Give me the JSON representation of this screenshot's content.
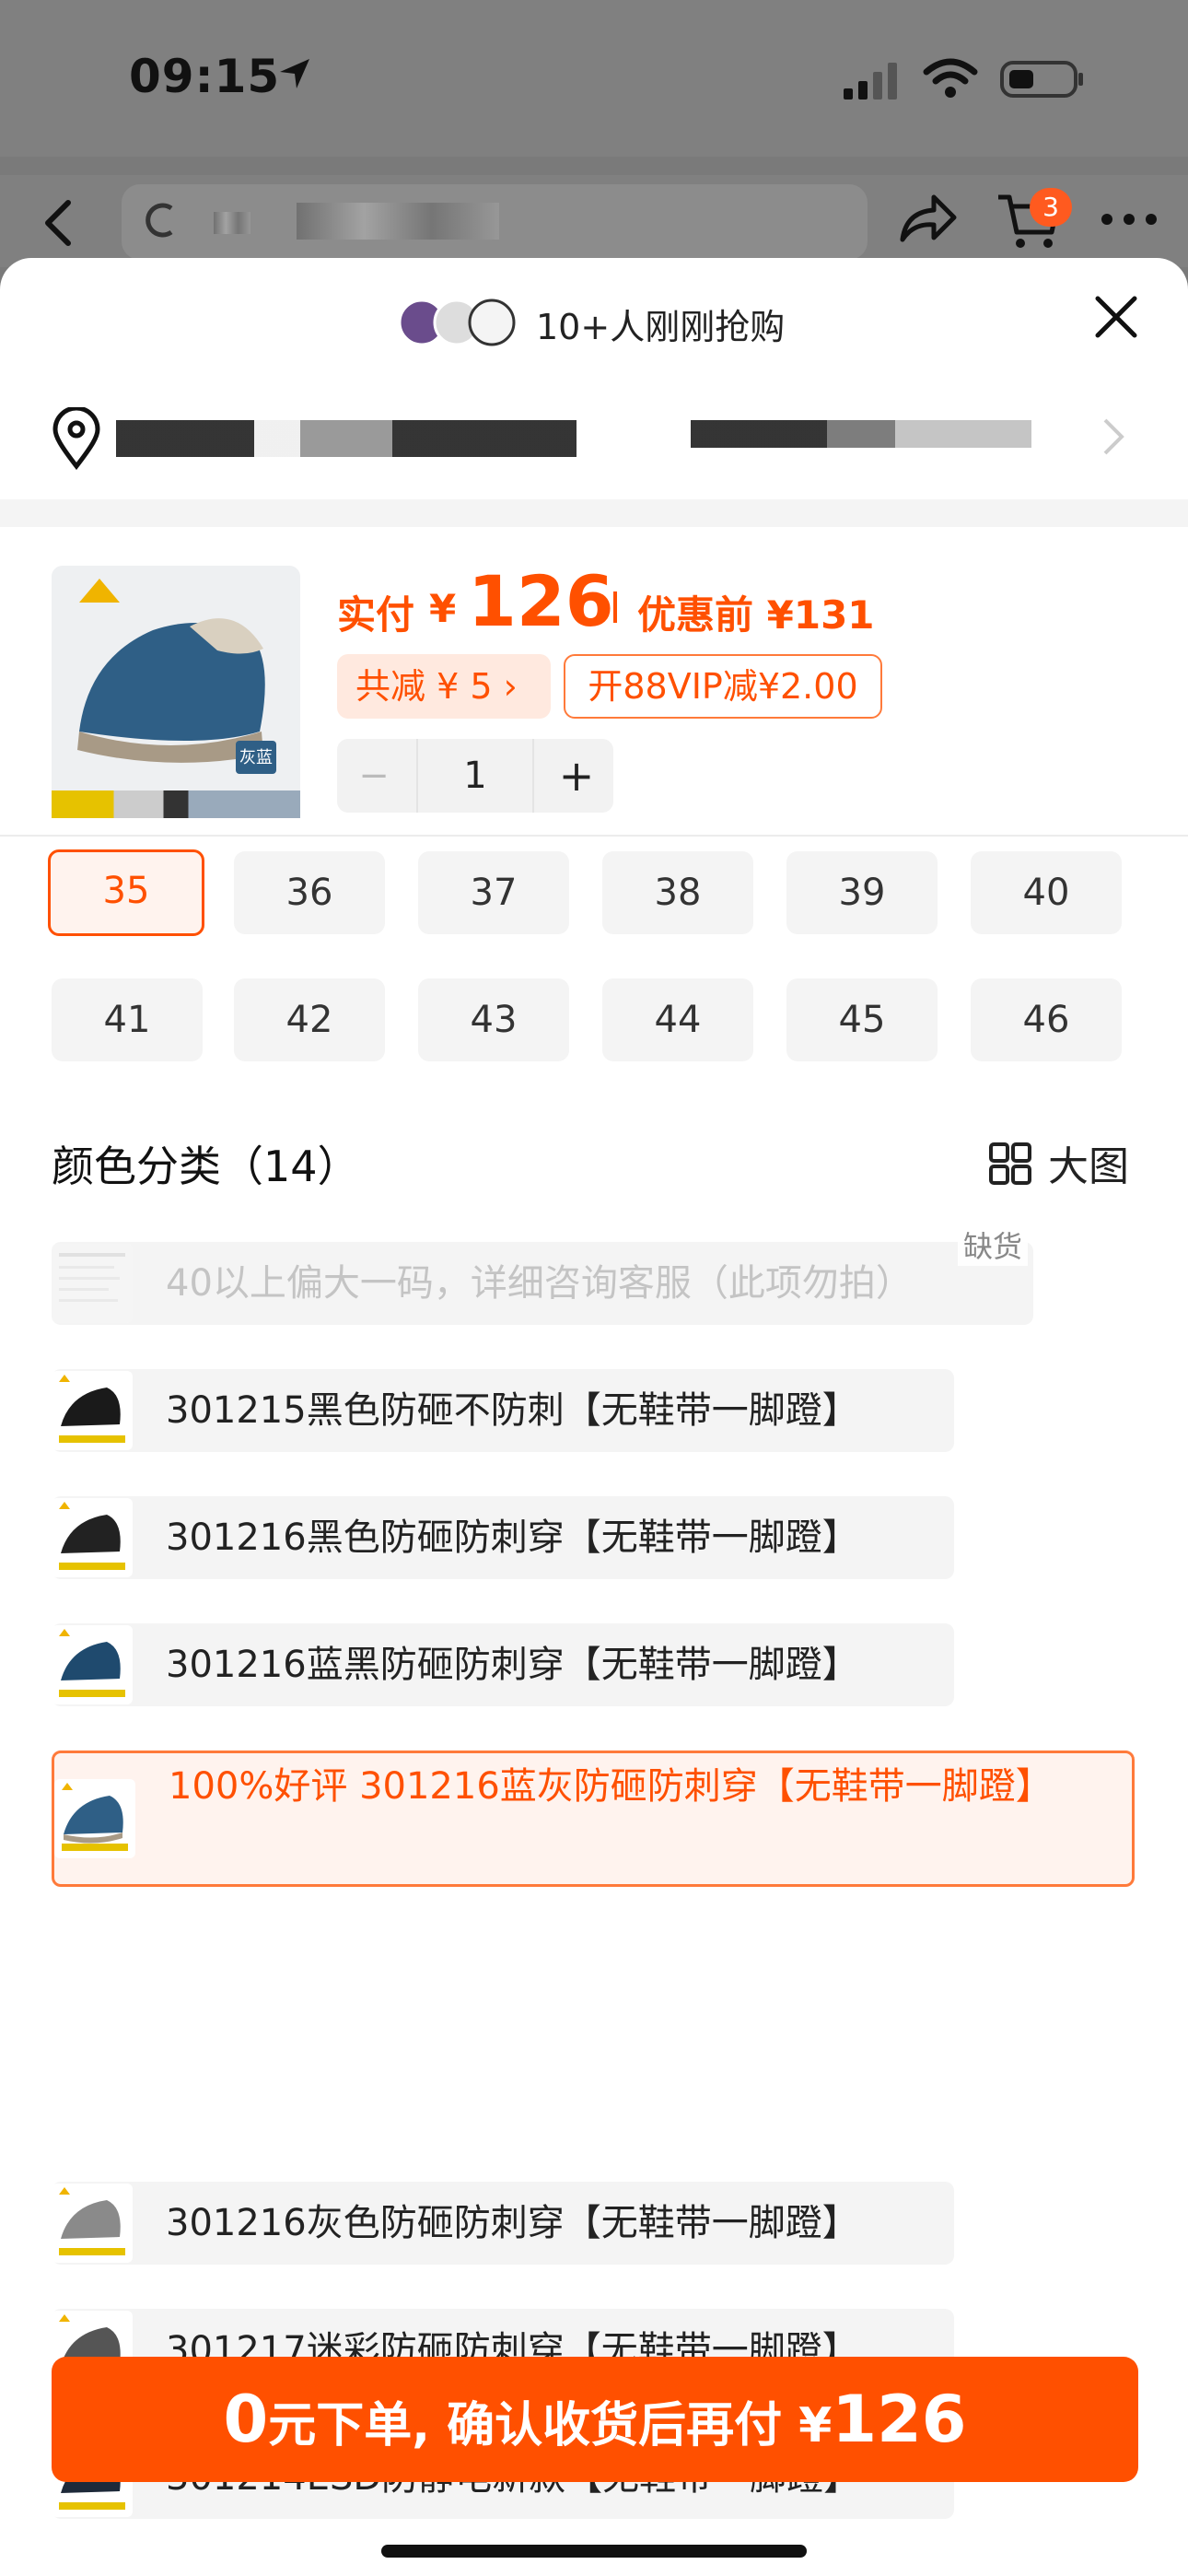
{
  "status_bar": {
    "time": "09:15"
  },
  "nav": {
    "cart_badge": "3"
  },
  "sheet_header": {
    "recent_buyers": "10+人刚刚抢购"
  },
  "product": {
    "pay_label": "实付",
    "currency": "¥",
    "pay_amount": "126",
    "original_price": "优惠前 ¥131",
    "discount_total": "共减 ¥ 5 ›",
    "vip_discount": "开88VIP减¥2.00",
    "image_tag": "灰蓝",
    "quantity": "1",
    "minus": "−",
    "plus": "+"
  },
  "sizes": {
    "selected": "35",
    "row1": [
      "35",
      "36",
      "37",
      "38",
      "39",
      "40"
    ],
    "row2": [
      "41",
      "42",
      "43",
      "44",
      "45",
      "46"
    ]
  },
  "colors": {
    "title": "颜色分类（14）",
    "big_image_label": "大图",
    "out_of_stock_label": "缺货",
    "options": [
      "40以上偏大一码，详细咨询客服（此项勿拍）",
      "301215黑色防砸不防刺【无鞋带一脚蹬】",
      "301216黑色防砸防刺穿【无鞋带一脚蹬】",
      "301216蓝黑防砸防刺穿【无鞋带一脚蹬】",
      "100%好评  301216蓝灰防砸防刺穿【无鞋带一脚蹬】",
      "301216灰色防砸防刺穿【无鞋带一脚蹬】",
      "301217迷彩防砸防刺穿【无鞋带一脚蹬】",
      "301214ESD防静电新款【无鞋带一脚蹬】"
    ]
  },
  "cta": {
    "big": "0",
    "text": "元下单, 确认收货后再付 ¥",
    "amount": "126"
  },
  "accent_color": "#ff5000"
}
